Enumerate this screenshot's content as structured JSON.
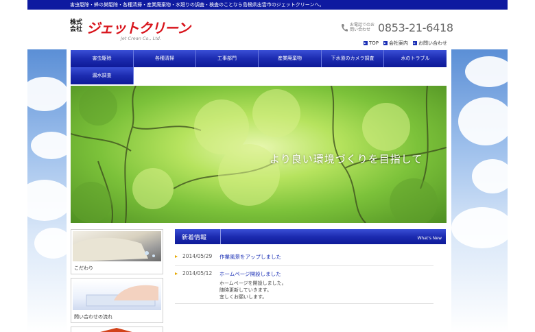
{
  "topbar": {
    "text": "害虫駆除・蜂の巣駆除・各種清掃・産業廃棄物・水廻りの調査・検査のことなら島根県出雲市のジェットクリーンへ。"
  },
  "header": {
    "logo_kaisha": "株式会社",
    "logo_main": "ジェットクリーン",
    "logo_sub": "Jet Crean Co., Ltd.",
    "phone_caption": "お電話でのお問い合わせ",
    "phone_number": "0853-21-6418",
    "links": [
      "TOP",
      "会社案内",
      "お問い合わせ"
    ]
  },
  "nav": {
    "items": [
      "害虫駆除",
      "各種清掃",
      "工事部門",
      "産業廃棄物",
      "下水道のカメラ調査",
      "水のトラブル",
      "漏水調査"
    ]
  },
  "hero": {
    "tagline": "より良い環境づくりを目指して"
  },
  "sidebar": {
    "cards": [
      "こだわり",
      "問い合わせの流れ"
    ]
  },
  "news": {
    "title": "新着情報",
    "subtitle": "What's New",
    "items": [
      {
        "date": "2014/05/29",
        "title": "作業風景をアップしました",
        "body": []
      },
      {
        "date": "2014/05/12",
        "title": "ホームページ開設しました",
        "body": [
          "ホームページを開設しました。",
          "随時更新していきます。",
          "宜しくお願いします。"
        ]
      }
    ]
  },
  "colors": {
    "brand_blue": "#0e1aa0",
    "logo_red": "#d8141c",
    "link_blue": "#1a2fb5",
    "news_arrow": "#e6a800"
  }
}
